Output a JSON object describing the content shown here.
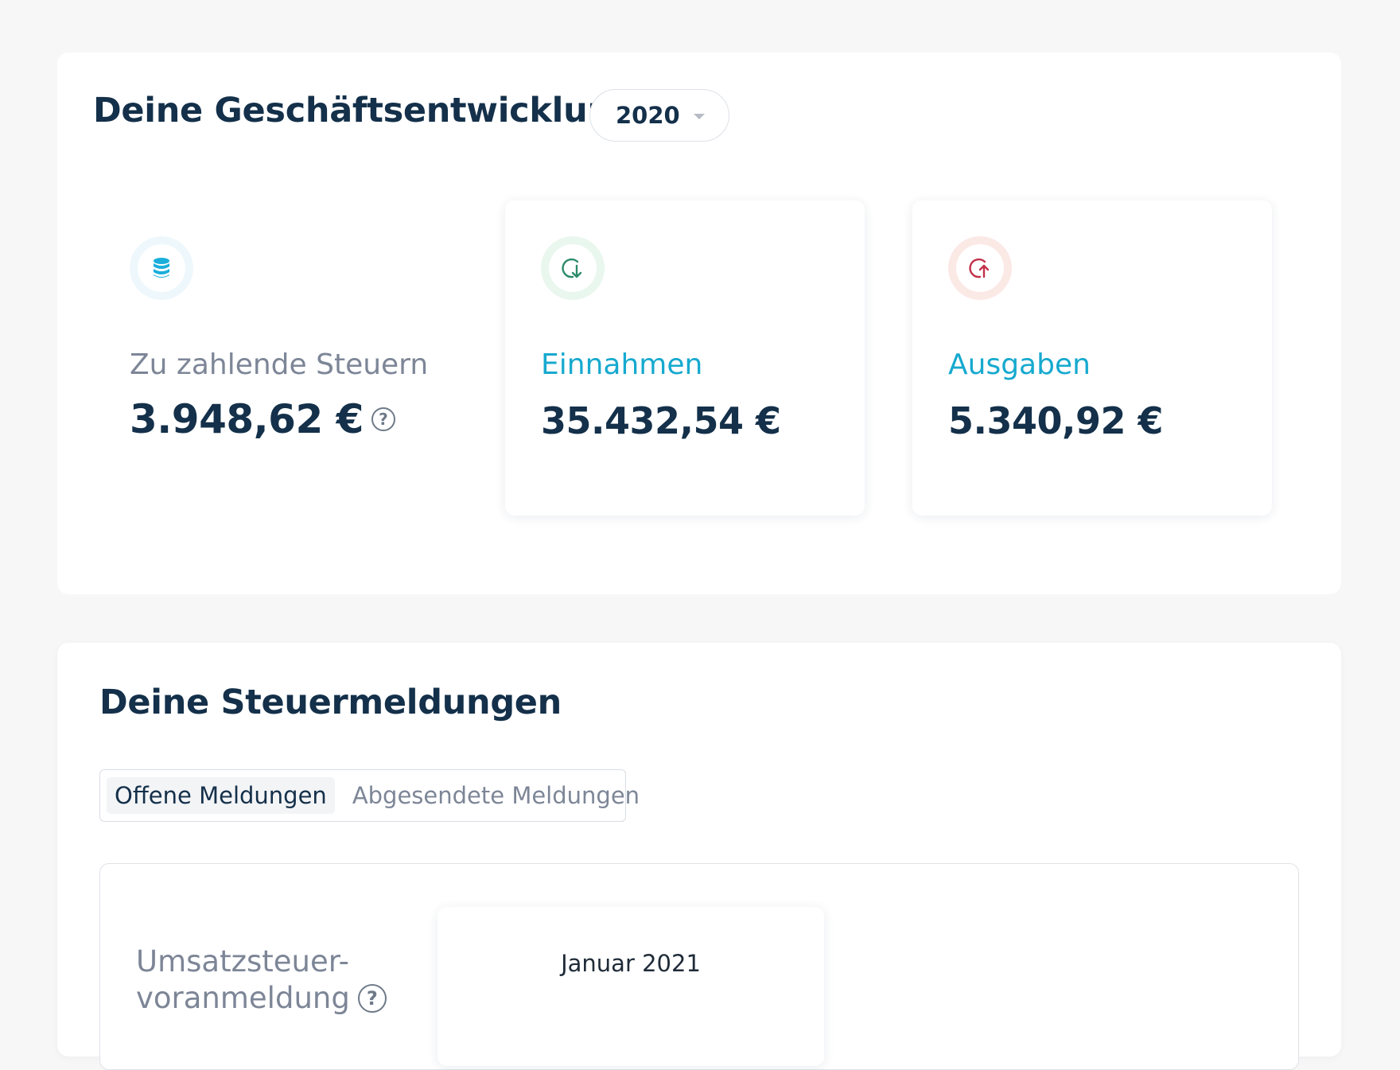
{
  "business": {
    "title": "Deine Geschäftsentwicklung",
    "year_selected": "2020",
    "metrics": {
      "taxes": {
        "label": "Zu zahlende Steuern",
        "value": "3.948,62 €",
        "icon": "database-icon",
        "label_color": "#7d8697",
        "accent": "#1aaedb"
      },
      "income": {
        "label": "Einnahmen",
        "value": "35.432,54 €",
        "icon": "circle-arrow-down-icon",
        "label_color": "#16a9cf",
        "accent": "#2d8a6a"
      },
      "expenses": {
        "label": "Ausgaben",
        "value": "5.340,92 €",
        "icon": "circle-arrow-up-icon",
        "label_color": "#16a9cf",
        "accent": "#c3304a"
      }
    }
  },
  "tax_reports": {
    "title": "Deine Steuermeldungen",
    "tabs": [
      {
        "label": "Offene Meldungen",
        "active": true
      },
      {
        "label": "Abgesendete Meldungen",
        "active": false
      }
    ],
    "report": {
      "type_line1": "Umsatzsteuer-",
      "type_line2": "voranmeldung",
      "month": "Januar 2021"
    }
  },
  "help_glyph": "?"
}
